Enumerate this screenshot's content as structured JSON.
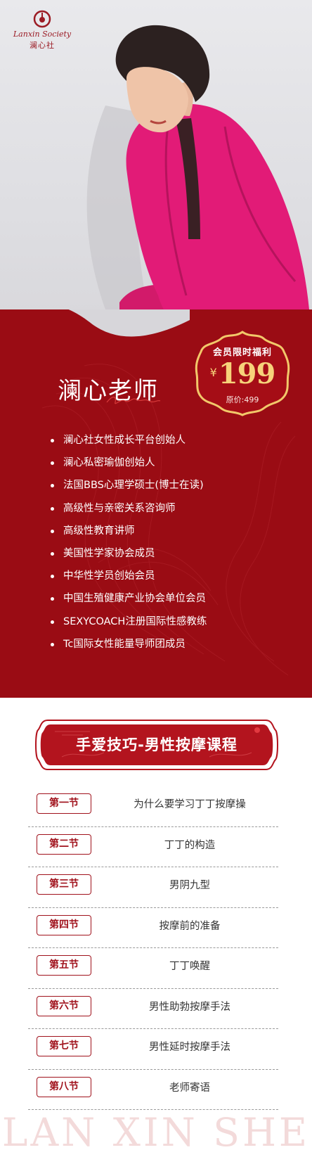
{
  "brand": {
    "logo_en": "Lanxin Society",
    "logo_cn": "澜心社",
    "accent": "#9a0c14",
    "gold": "#f7d27a"
  },
  "teacher": {
    "name": "澜心老师"
  },
  "price": {
    "title": "会员限时福利",
    "currency": "¥",
    "value": "199",
    "original": "原价:499"
  },
  "credentials": [
    "澜心社女性成长平台创始人",
    "澜心私密瑜伽创始人",
    "法国BBS心理学硕士(博士在读)",
    "高级性与亲密关系咨询师",
    "高级性教育讲师",
    "美国性学家协会成员",
    "中华性学员创始会员",
    "中国生殖健康产业协会单位会员",
    "SEXYCOACH注册国际性感教练",
    "Tc国际女性能量导师团成员"
  ],
  "course": {
    "title": "手爱技巧-男性按摩课程"
  },
  "lessons": [
    {
      "tag": "第一节",
      "title": "为什么要学习丁丁按摩操"
    },
    {
      "tag": "第二节",
      "title": "丁丁的构造"
    },
    {
      "tag": "第三节",
      "title": "男阴九型"
    },
    {
      "tag": "第四节",
      "title": "按摩前的准备"
    },
    {
      "tag": "第五节",
      "title": "丁丁唤醒"
    },
    {
      "tag": "第六节",
      "title": "男性助勃按摩手法"
    },
    {
      "tag": "第七节",
      "title": "男性延时按摩手法"
    },
    {
      "tag": "第八节",
      "title": "老师寄语"
    }
  ],
  "watermark": "LAN XIN SHE"
}
